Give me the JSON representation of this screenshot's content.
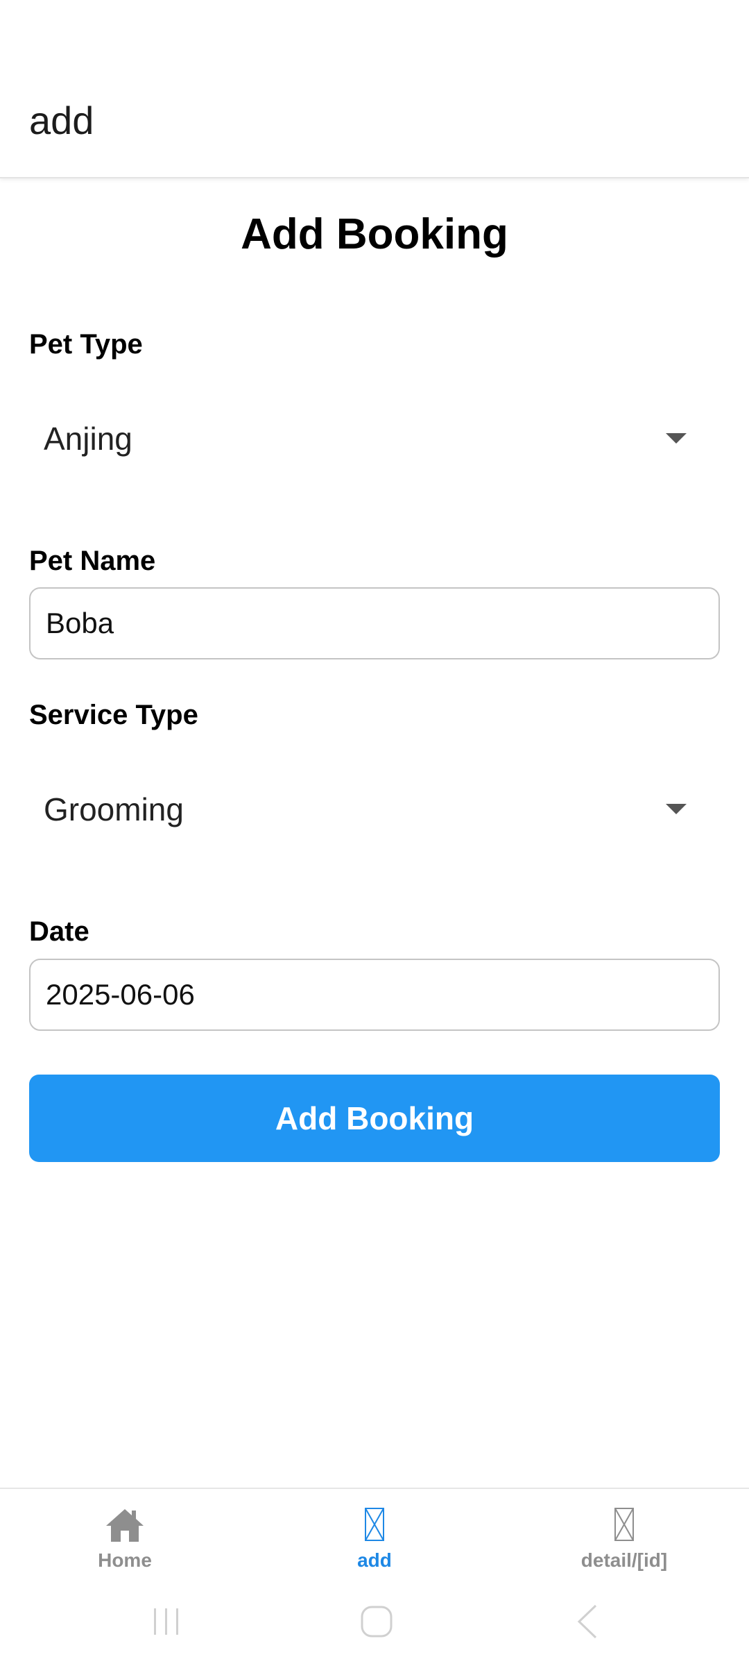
{
  "header": {
    "title": "add"
  },
  "form": {
    "title": "Add Booking",
    "pet_type": {
      "label": "Pet Type",
      "value": "Anjing"
    },
    "pet_name": {
      "label": "Pet Name",
      "value": "Boba"
    },
    "service_type": {
      "label": "Service Type",
      "value": "Grooming"
    },
    "date": {
      "label": "Date",
      "value": "2025-06-06"
    },
    "submit_label": "Add Booking"
  },
  "tabs": [
    {
      "label": "Home",
      "icon": "home-icon",
      "active": false
    },
    {
      "label": "add",
      "icon": "placeholder-icon",
      "active": true
    },
    {
      "label": "detail/[id]",
      "icon": "placeholder-icon",
      "active": false
    }
  ],
  "colors": {
    "accent": "#2196f3",
    "tab_active": "#1e88e5",
    "tab_inactive": "#8e8e8e"
  }
}
